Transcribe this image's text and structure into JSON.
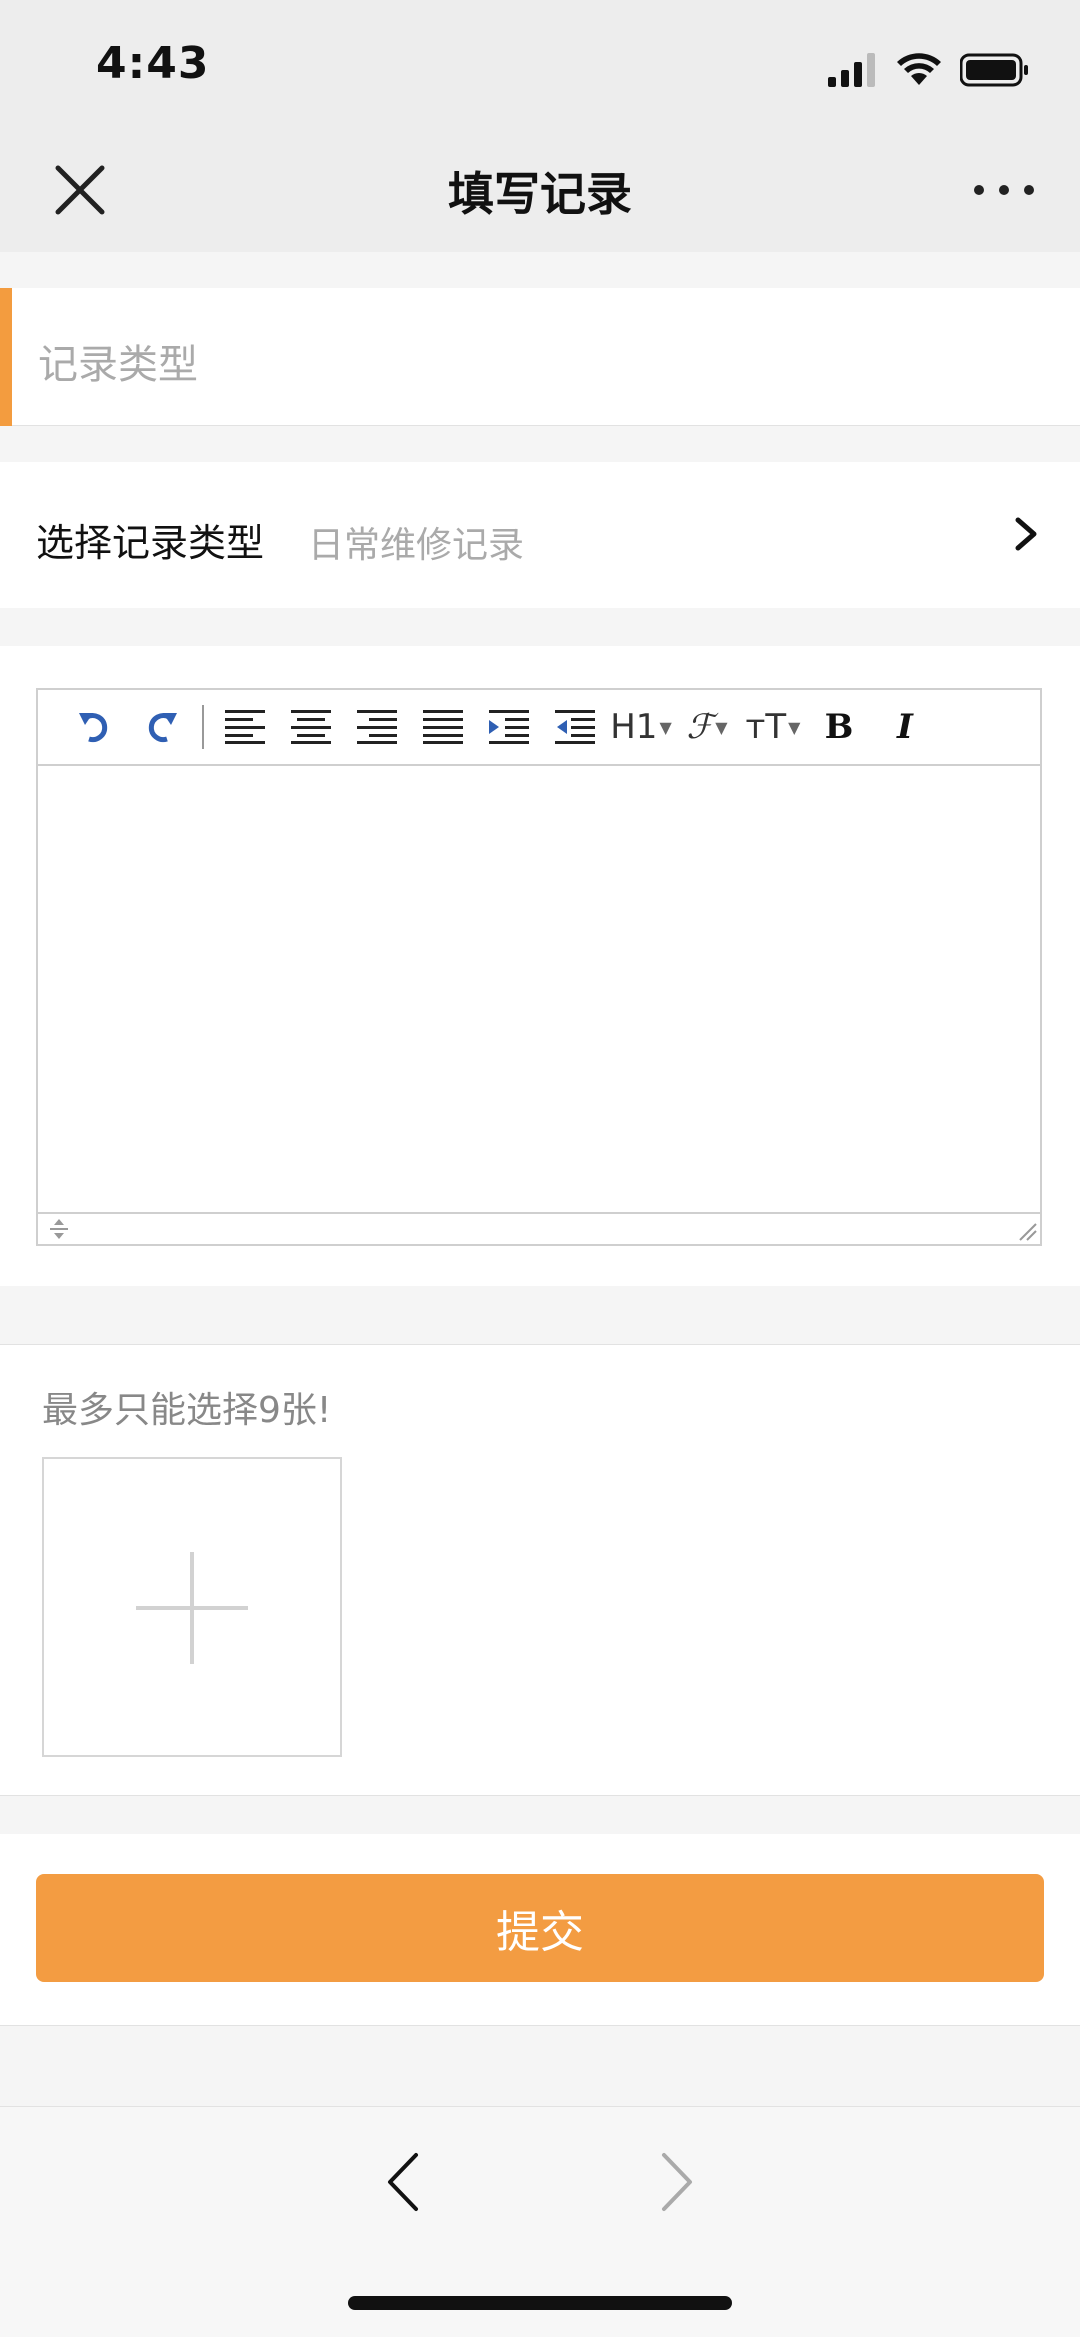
{
  "status_bar": {
    "time": "4:43"
  },
  "nav": {
    "title": "填写记录"
  },
  "record_type": {
    "title": "记录类型"
  },
  "select_type": {
    "label": "选择记录类型",
    "value": "日常维修记录"
  },
  "editor": {
    "toolbar": {
      "heading": "H1",
      "font_family": "ℱ",
      "font_size": "тT",
      "bold": "B",
      "italic": "I"
    }
  },
  "upload": {
    "hint": "最多只能选择9张!"
  },
  "submit": {
    "label": "提交"
  },
  "colors": {
    "accent": "#f39c42",
    "placeholder": "#aaaaaa"
  }
}
